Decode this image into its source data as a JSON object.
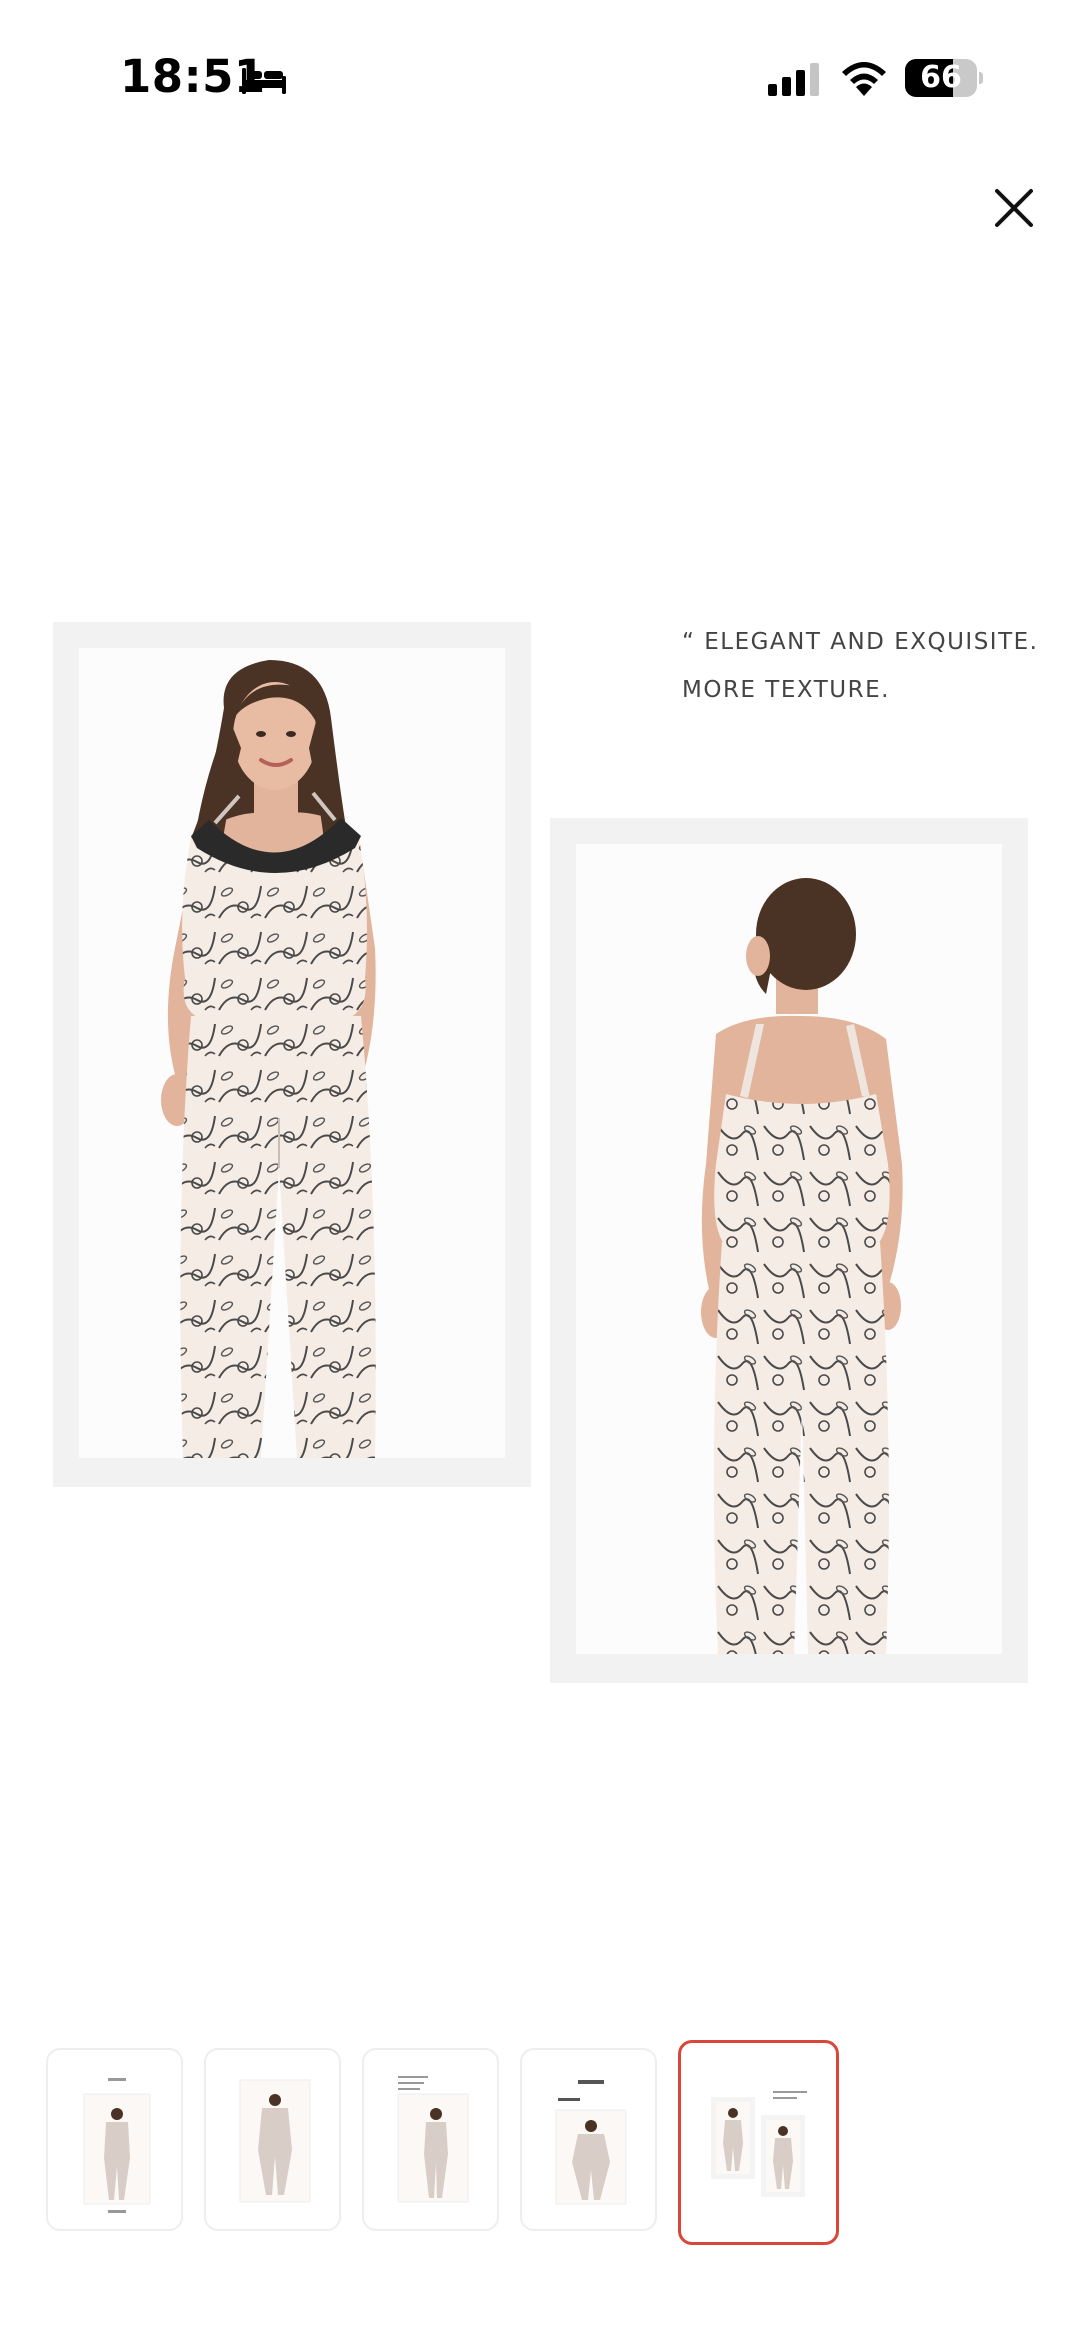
{
  "status_bar": {
    "time": "18:51",
    "battery_level": "66",
    "battery_fraction": 0.66,
    "icons": [
      "bed-icon",
      "signal-icon",
      "wifi-icon",
      "battery-icon"
    ]
  },
  "viewer": {
    "close_icon": "close-icon",
    "tagline": {
      "line1": "“ ELEGANT AND EXQUISITE.",
      "line2": "MORE TEXTURE."
    }
  },
  "thumbnails": {
    "count": 5,
    "selected_index": 4,
    "selected_border_color": "#d9473b"
  },
  "colors": {
    "background": "#ffffff",
    "frame": "#f2f2f2",
    "fabric": "#f6ece6",
    "print": "#4a4a4a",
    "lace": "#2a2a2a",
    "hair": "#4a3224",
    "skin": "#e2b49c"
  }
}
